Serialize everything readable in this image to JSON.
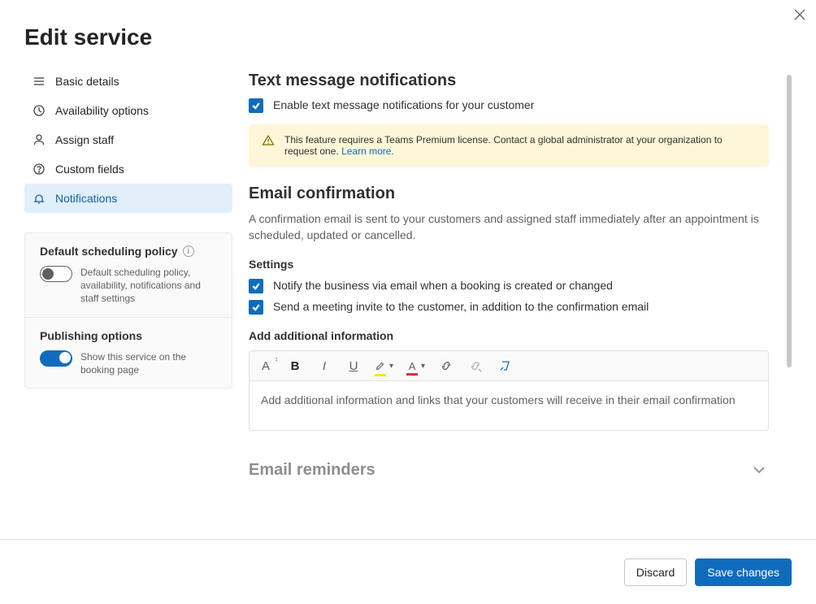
{
  "title": "Edit service",
  "nav": [
    {
      "label": "Basic details"
    },
    {
      "label": "Availability options"
    },
    {
      "label": "Assign staff"
    },
    {
      "label": "Custom fields"
    },
    {
      "label": "Notifications"
    }
  ],
  "policy": {
    "heading": "Default scheduling policy",
    "desc": "Default scheduling policy, availability, notifications and staff settings"
  },
  "publish": {
    "heading": "Publishing options",
    "desc": "Show this service on the booking page"
  },
  "sms": {
    "heading": "Text message notifications",
    "checkbox_label": "Enable text message notifications for your customer",
    "banner_text": "This feature requires a Teams Premium license. Contact a global administrator at your organization to request one.",
    "banner_link": "Learn more."
  },
  "email": {
    "heading": "Email confirmation",
    "desc": "A confirmation email is sent to your customers and assigned staff immediately after an appointment is scheduled, updated or cancelled.",
    "settings_label": "Settings",
    "cb1": "Notify the business via email when a booking is created or changed",
    "cb2": "Send a meeting invite to the customer, in addition to the confirmation email",
    "add_title": "Add additional information",
    "add_placeholder": "Add additional information and links that your customers will receive in their email confirmation"
  },
  "rte": {
    "font": "A",
    "bold": "B",
    "italic": "I",
    "underline": "U",
    "highlight": "marker-icon",
    "fontcolor": "A",
    "link": "link-icon",
    "unlink": "unlink-icon",
    "clear": "format-clear-icon"
  },
  "reminders": {
    "heading": "Email reminders"
  },
  "footer": {
    "discard": "Discard",
    "save": "Save changes"
  }
}
